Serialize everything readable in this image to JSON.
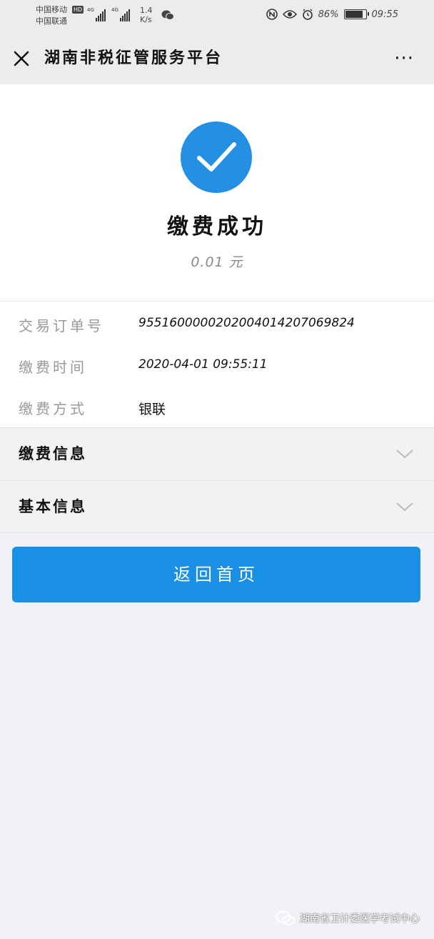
{
  "status_bar": {
    "carrier_1": "中国移动",
    "carrier_2": "中国联通",
    "hd_label": "HD",
    "signal_1_gen": "4G",
    "signal_2_gen": "4G",
    "net_speed_value": "1.4",
    "net_speed_unit": "K/s",
    "battery_percent": "86%",
    "battery_level": 0.86,
    "time": "09:55",
    "icons": [
      "wechat-icon",
      "nfc-icon",
      "eye-icon",
      "alarm-icon",
      "battery-icon"
    ]
  },
  "navbar": {
    "title": "湖南非税征管服务平台",
    "more_label": "···"
  },
  "result": {
    "title": "缴费成功",
    "amount": "0.01 元",
    "accent_color": "#2390e4"
  },
  "details": [
    {
      "label": "交易订单号",
      "value": "95516000002020040142070698​24"
    },
    {
      "label": "缴费时间",
      "value": "2020-04-01 09:55:11"
    },
    {
      "label": "缴费方式",
      "value": "银联"
    }
  ],
  "sections": [
    {
      "label": "缴费信息"
    },
    {
      "label": "基本信息"
    }
  ],
  "home_button": {
    "label": "返回首页",
    "color": "#1a8fe6"
  },
  "watermark": {
    "text": "湖南省卫计委医学考试中心"
  }
}
